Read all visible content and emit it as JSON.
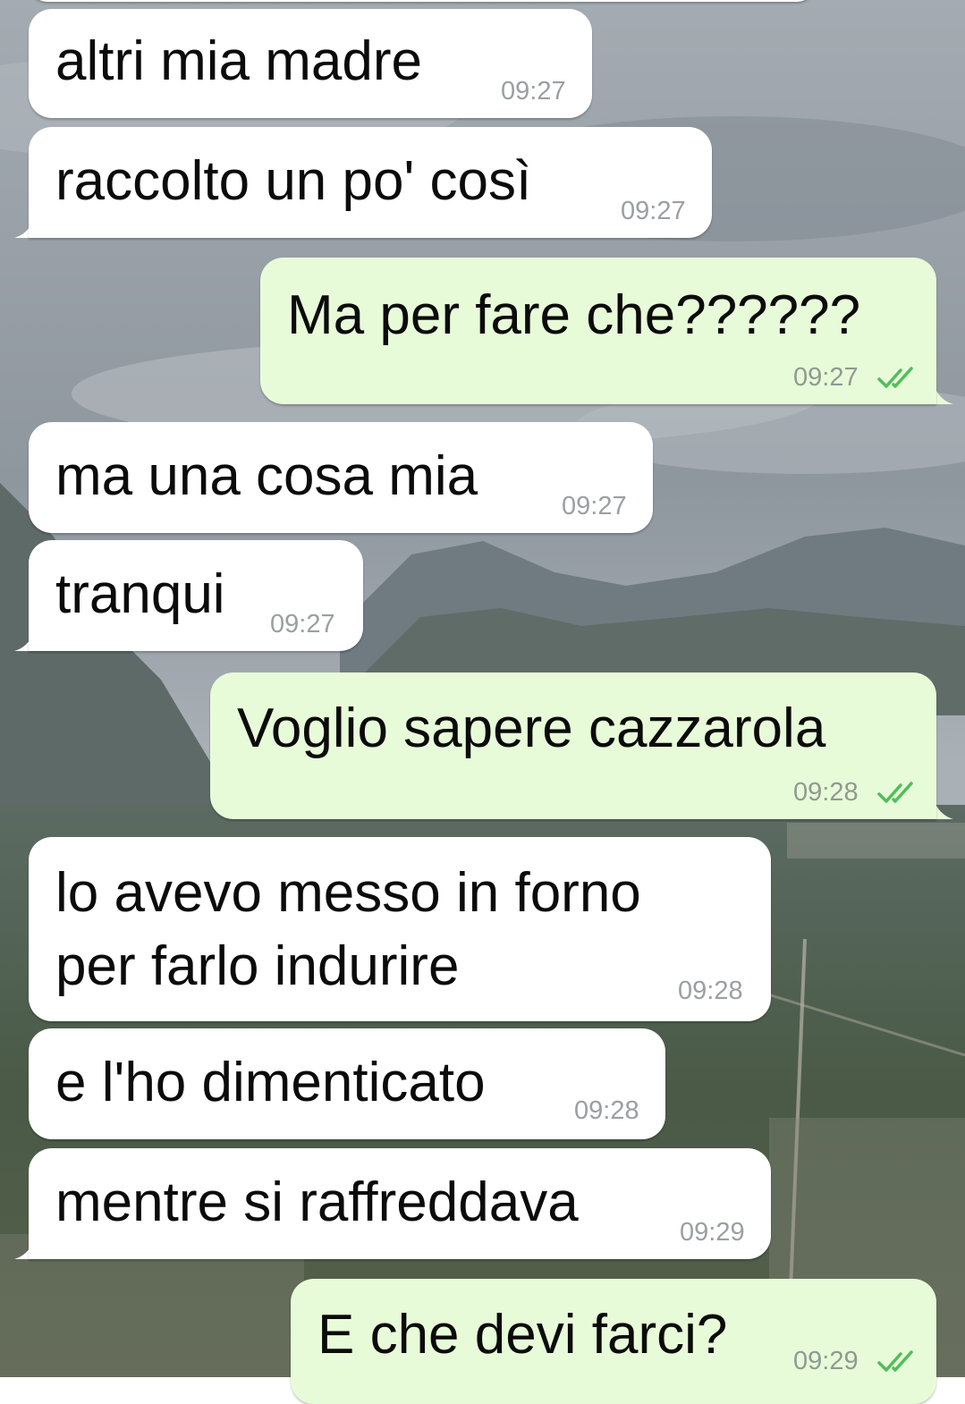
{
  "wallpaper": {
    "description_icon": "mountain-landscape-wallpaper",
    "sky_color": "#9ba3ab",
    "mountain_color": "#5a6a66",
    "plain_color": "#4a5a44"
  },
  "colors": {
    "incoming_bubble": "#ffffff",
    "outgoing_bubble": "#e8fbd9",
    "read_ticks": "#4fbf5a"
  },
  "messages": [
    {
      "direction": "in",
      "lines": [
        "altri mia madre"
      ],
      "time": "09:27"
    },
    {
      "direction": "in",
      "lines": [
        "raccolto un po' così"
      ],
      "time": "09:27"
    },
    {
      "direction": "out",
      "lines": [
        "Ma per fare che??????"
      ],
      "time": "09:27",
      "status_icon": "double-check-icon"
    },
    {
      "direction": "in",
      "lines": [
        "ma una cosa mia"
      ],
      "time": "09:27"
    },
    {
      "direction": "in",
      "lines": [
        "tranqui"
      ],
      "time": "09:27"
    },
    {
      "direction": "out",
      "lines": [
        "Voglio sapere cazzarola"
      ],
      "time": "09:28",
      "status_icon": "double-check-icon"
    },
    {
      "direction": "in",
      "lines": [
        "lo avevo messo in forno",
        "per farlo indurire"
      ],
      "time": "09:28"
    },
    {
      "direction": "in",
      "lines": [
        "e l'ho dimenticato"
      ],
      "time": "09:28"
    },
    {
      "direction": "in",
      "lines": [
        "mentre si raffreddava"
      ],
      "time": "09:29"
    },
    {
      "direction": "out",
      "lines": [
        "E che devi farci?"
      ],
      "time": "09:29",
      "status_icon": "double-check-icon"
    }
  ]
}
